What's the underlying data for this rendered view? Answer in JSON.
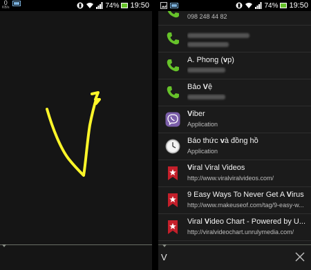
{
  "status_bar": {
    "left_screen": {
      "data_count": "0",
      "data_unit": "KB/s",
      "battery": "74%",
      "time": "19:50"
    },
    "right_screen": {
      "battery": "74%",
      "time": "19:50"
    }
  },
  "gesture": {
    "letter_drawn": "V",
    "stroke_color": "#fcf529"
  },
  "results": [
    {
      "type": "contact",
      "title_pre": "",
      "title_mark": "",
      "title_post": "",
      "sub": "098 248 44 82",
      "icon": "phone-icon"
    },
    {
      "type": "contact",
      "title_pre": "",
      "title_mark": "",
      "title_post": "",
      "sub": "",
      "icon": "phone-icon"
    },
    {
      "type": "contact",
      "title_pre": "A. Phong (",
      "title_mark": "v",
      "title_post": "p)",
      "sub": "",
      "icon": "phone-icon"
    },
    {
      "type": "contact",
      "title_pre": "Bảo ",
      "title_mark": "V",
      "title_post": "ệ",
      "sub": "",
      "icon": "phone-icon"
    },
    {
      "type": "app",
      "title_pre": "",
      "title_mark": "V",
      "title_post": "iber",
      "sub": "Application",
      "icon": "viber-icon"
    },
    {
      "type": "app",
      "title_pre": "Báo thức ",
      "title_mark": "v",
      "title_post": "à đồng hồ",
      "sub": "Application",
      "icon": "clock-icon"
    },
    {
      "type": "bookmark",
      "title_pre": "",
      "title_mark": "V",
      "title_post": "iral Viral Videos",
      "sub": "http://www.viralviralvideos.com/",
      "icon": "bookmark-icon"
    },
    {
      "type": "bookmark",
      "title_pre": "9 Easy Ways To Never Get A ",
      "title_mark": "V",
      "title_post": "irus",
      "sub": "http://www.makeuseof.com/tag/9-easy-w...",
      "icon": "bookmark-icon"
    },
    {
      "type": "bookmark",
      "title_pre": "Viral ",
      "title_mark": "V",
      "title_post": "ideo Chart - Powered by U...",
      "sub": "http://viralvideochart.unrulymedia.com/",
      "icon": "bookmark-icon"
    }
  ],
  "search": {
    "query": "V"
  },
  "colors": {
    "phone_green": "#66c22a",
    "viber_purple": "#7b5ea9",
    "bookmark_red": "#c41f2a",
    "stroke_yellow": "#fcf529"
  }
}
